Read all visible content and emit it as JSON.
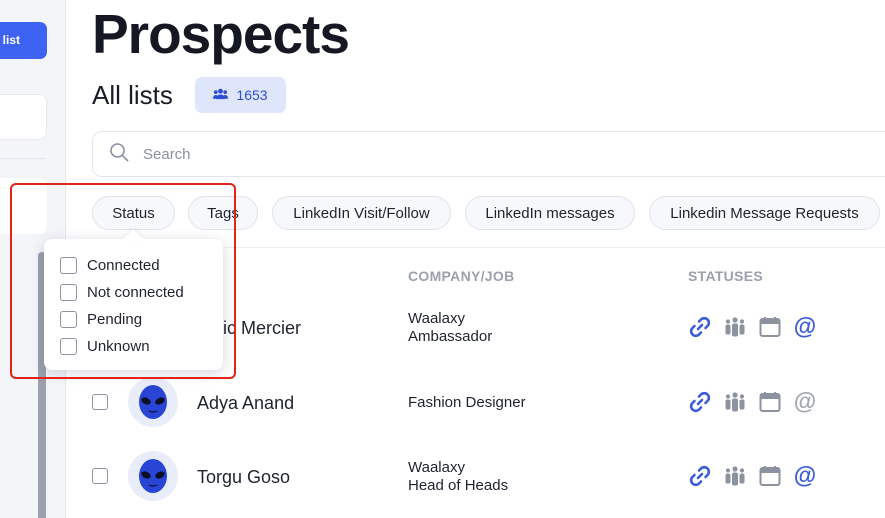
{
  "page": {
    "title": "Prospects",
    "subtitle": "All lists"
  },
  "sidebar": {
    "button_label": "list"
  },
  "count_badge": {
    "icon": "users-icon",
    "value": "1653"
  },
  "search": {
    "placeholder": "Search",
    "icon": "search-icon"
  },
  "filters": [
    "Status",
    "Tags",
    "LinkedIn Visit/Follow",
    "LinkedIn messages",
    "Linkedin Message Requests"
  ],
  "status_dropdown": {
    "options": [
      "Connected",
      "Not connected",
      "Pending",
      "Unknown"
    ]
  },
  "table": {
    "headers": {
      "company": "COMPANY/JOB",
      "statuses": "STATUSES"
    },
    "rows": [
      {
        "name": "déric Mercier",
        "company_line1": "Waalaxy",
        "company_line2": "Ambassador",
        "email_active": true
      },
      {
        "name": "Adya Anand",
        "company_line1": "Fashion Designer",
        "company_line2": "",
        "email_active": false
      },
      {
        "name": "Torgu Goso",
        "company_line1": "Waalaxy",
        "company_line2": "Head of Heads",
        "email_active": true
      }
    ]
  },
  "colors": {
    "accent": "#3e63f2",
    "icon_blue": "#3b5bdb",
    "icon_grey": "#8d92a0",
    "highlight": "#e2231a"
  }
}
